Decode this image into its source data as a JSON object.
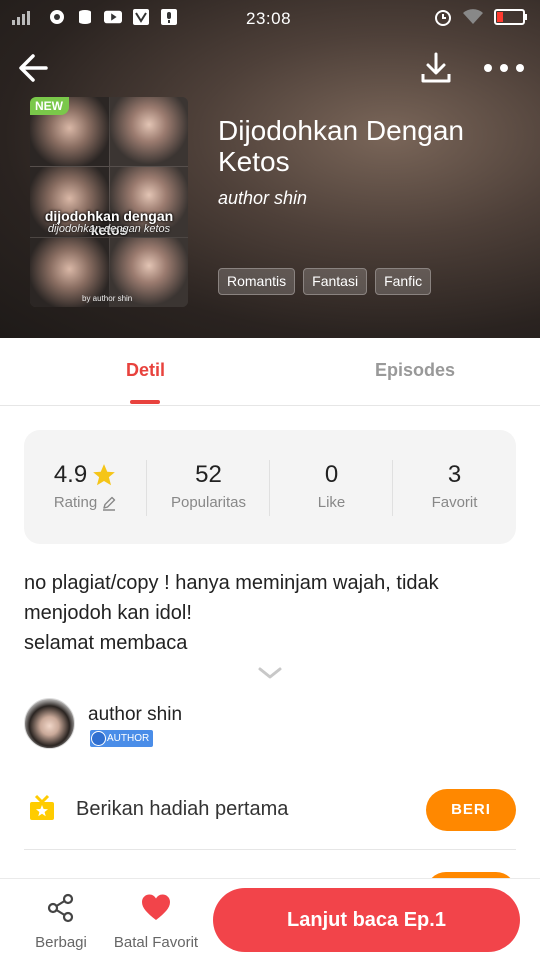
{
  "status_bar": {
    "time": "23:08"
  },
  "header": {
    "back_icon": "arrow-left-icon",
    "download_icon": "download-icon",
    "more_icon": "more-dots-icon"
  },
  "book": {
    "badge": "NEW",
    "cover_title": "dijodohkan dengan ketos",
    "cover_subtitle": "dijodohkan dengan ketos",
    "cover_author": "by author shin",
    "title": "Dijodohkan Dengan Ketos",
    "author": "author shin",
    "tags": [
      "Romantis",
      "Fantasi",
      "Fanfic"
    ]
  },
  "tabs": {
    "detail": "Detil",
    "episodes": "Episodes",
    "active": "Detil"
  },
  "stats": {
    "rating": {
      "value": "4.9",
      "label": "Rating"
    },
    "popularity": {
      "value": "52",
      "label": "Popularitas"
    },
    "like": {
      "value": "0",
      "label": "Like"
    },
    "favorite": {
      "value": "3",
      "label": "Favorit"
    }
  },
  "synopsis": {
    "line1": "no plagiat/copy ! hanya meminjam wajah, tidak",
    "line2": "menjodoh kan idol!",
    "line3": "selamat membaca"
  },
  "author_section": {
    "name": "author shin",
    "badge": "AUTHOR"
  },
  "gift": {
    "text": "Berikan hadiah pertama",
    "button": "BERI"
  },
  "bottom_bar": {
    "share_label": "Berbagi",
    "favorite_label": "Batal Favorit",
    "read_button": "Lanjut baca Ep.1"
  },
  "colors": {
    "accent": "#e8423d",
    "primary_button": "#f2444a",
    "gift_button": "#ff8800",
    "new_badge": "#7ac84a",
    "star": "#f5c518"
  }
}
